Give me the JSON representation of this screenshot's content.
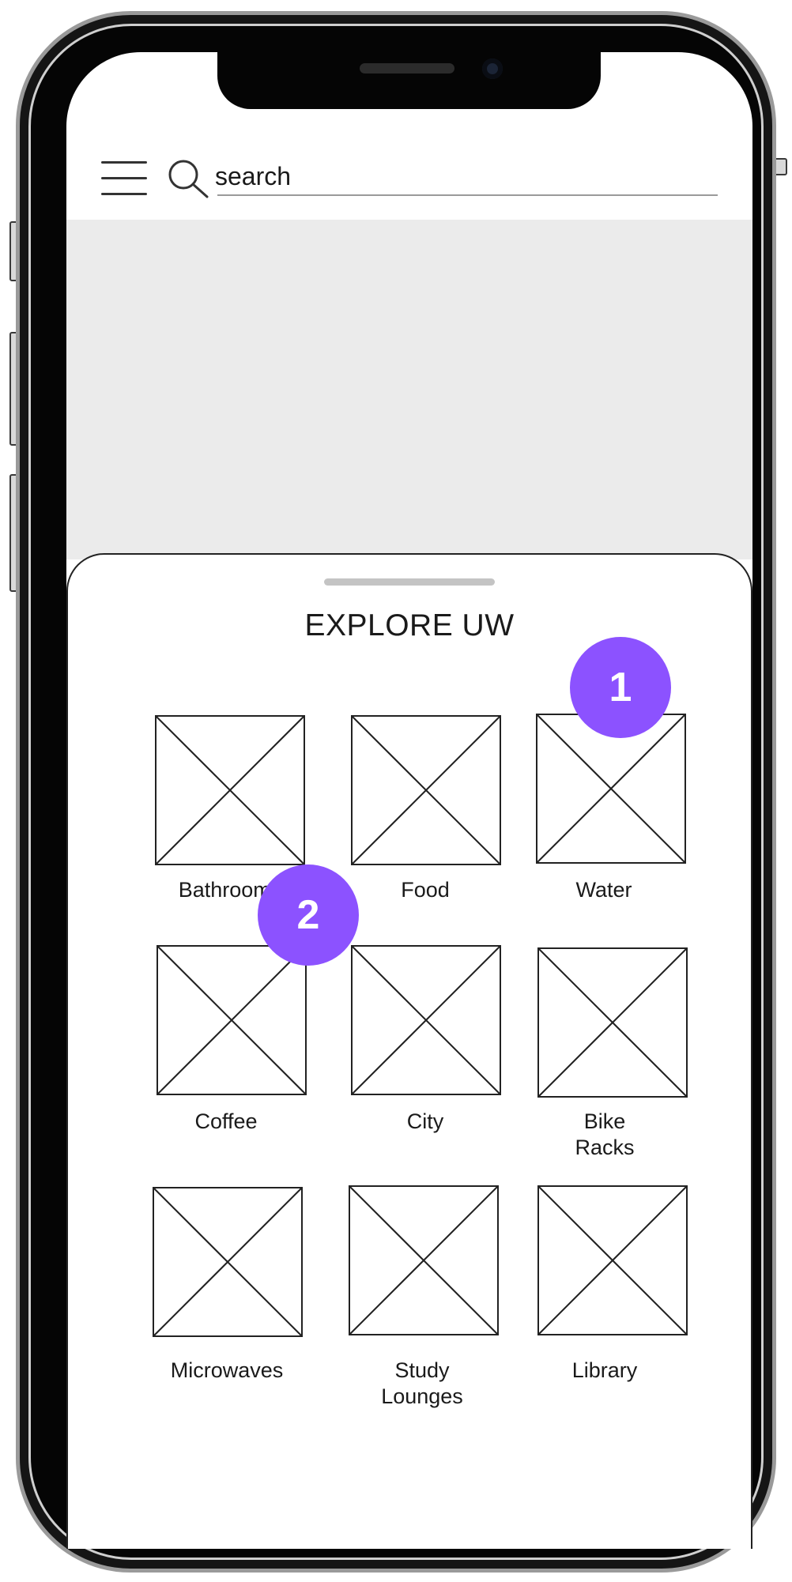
{
  "header": {
    "menu_icon": "hamburger-menu-icon",
    "search_icon": "search-icon",
    "search_placeholder": "search"
  },
  "sheet": {
    "title": "EXPLORE UW",
    "tiles": [
      {
        "label": "Bathrooms",
        "image": "placeholder-image-icon"
      },
      {
        "label": "Food",
        "image": "placeholder-image-icon"
      },
      {
        "label": "Water",
        "image": "placeholder-image-icon"
      },
      {
        "label": "Coffee",
        "image": "placeholder-image-icon"
      },
      {
        "label": "City",
        "image": "placeholder-image-icon"
      },
      {
        "label": "Bike\nRacks",
        "image": "placeholder-image-icon"
      },
      {
        "label": "Microwaves",
        "image": "placeholder-image-icon"
      },
      {
        "label": "Study\nLounges",
        "image": "placeholder-image-icon"
      },
      {
        "label": "Library",
        "image": "placeholder-image-icon"
      }
    ]
  },
  "annotations": [
    {
      "number": "1"
    },
    {
      "number": "2"
    }
  ],
  "colors": {
    "marker": "#8c52ff",
    "map_background": "#ebebeb",
    "frame": "#050505"
  }
}
